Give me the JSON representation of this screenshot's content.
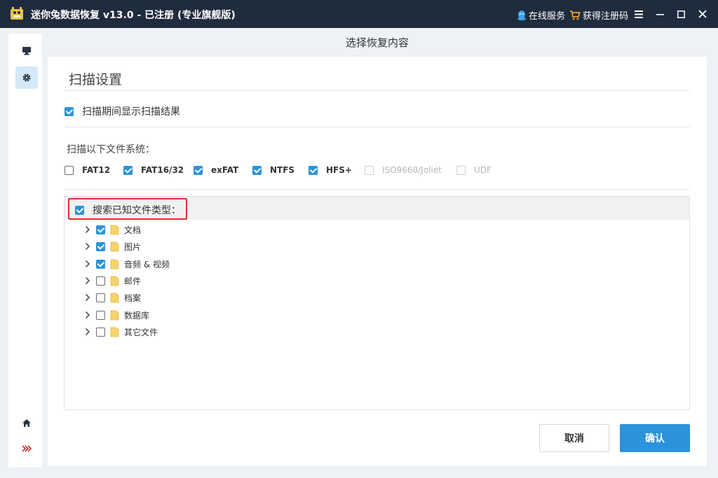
{
  "titlebar": {
    "title": "迷你兔数据恢复 v13.0 - 已注册 (专业旗舰版)",
    "online_service": "在线服务",
    "get_code": "获得注册码"
  },
  "heading": "选择恢复内容",
  "panel": {
    "title": "扫描设置",
    "show_results": {
      "label": "扫描期间显示扫描结果",
      "checked": true
    },
    "fs_label": "扫描以下文件系统：",
    "filesystems": [
      {
        "label": "FAT12",
        "checked": false,
        "disabled": false
      },
      {
        "label": "FAT16/32",
        "checked": true,
        "disabled": false
      },
      {
        "label": "exFAT",
        "checked": true,
        "disabled": false
      },
      {
        "label": "NTFS",
        "checked": true,
        "disabled": false
      },
      {
        "label": "HFS+",
        "checked": true,
        "disabled": false
      },
      {
        "label": "ISO9660/Joliet",
        "checked": false,
        "disabled": true
      },
      {
        "label": "UDF",
        "checked": false,
        "disabled": true
      }
    ],
    "known_types": {
      "label": "搜索已知文件类型：",
      "checked": true
    },
    "tree": [
      {
        "label": "文档",
        "checked": true
      },
      {
        "label": "图片",
        "checked": true
      },
      {
        "label": "音频 & 视频",
        "checked": true
      },
      {
        "label": "邮件",
        "checked": false
      },
      {
        "label": "档案",
        "checked": false
      },
      {
        "label": "数据库",
        "checked": false
      },
      {
        "label": "其它文件",
        "checked": false
      }
    ]
  },
  "buttons": {
    "cancel": "取消",
    "ok": "确认"
  },
  "colors": {
    "titlebar": "#1f2c3d",
    "accent": "#2b93d9",
    "highlight": "#e33030",
    "folder": "#f7d36b"
  }
}
